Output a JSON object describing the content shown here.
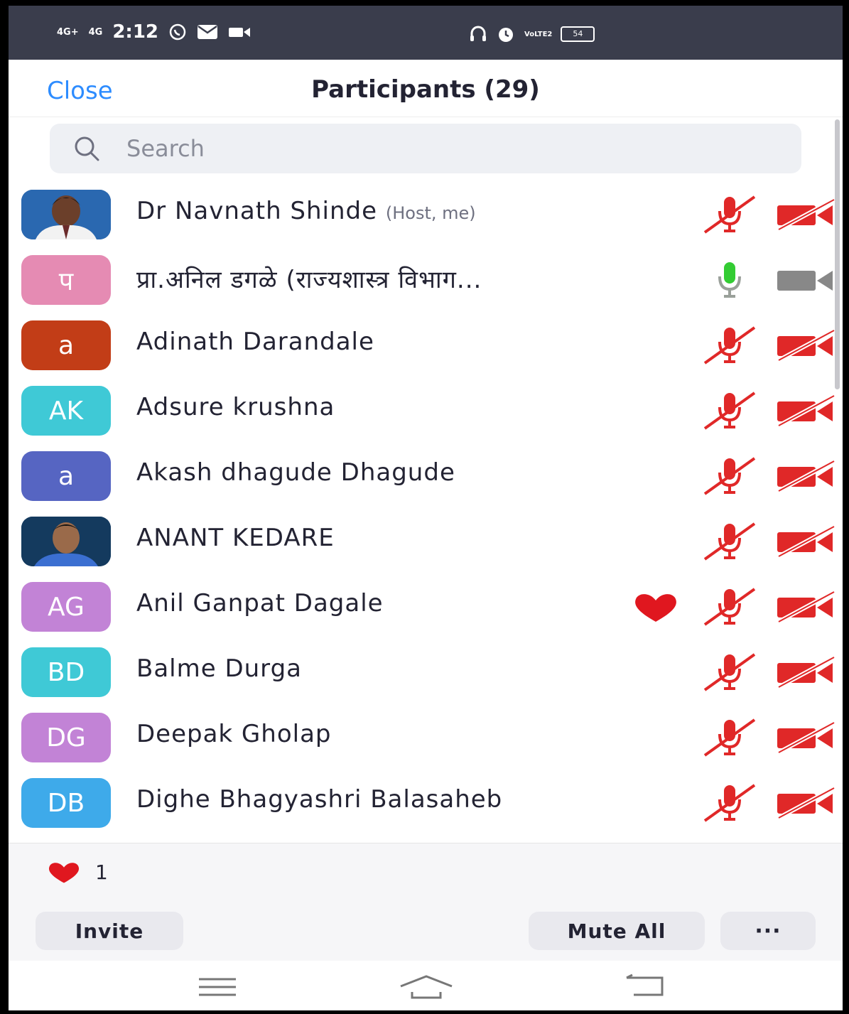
{
  "status_bar": {
    "signal1": "4G+",
    "signal2": "4G",
    "time": "2:12",
    "volte": "VoLTE2",
    "battery": "54"
  },
  "header": {
    "close_label": "Close",
    "title": "Participants (29)"
  },
  "search": {
    "placeholder": "Search"
  },
  "colors": {
    "accent": "#2d8cff",
    "muted_red": "#e02828",
    "active_mic": "#33cc33",
    "status_bar": "#3a3d4c"
  },
  "participants": [
    {
      "initials": "",
      "photo": "photo-avatar-1",
      "name": "Dr Navnath Shinde",
      "tag": "(Host, me)",
      "mic": "muted",
      "video": "off",
      "reaction": ""
    },
    {
      "initials": "प",
      "color": "#e58bb3",
      "name": "प्रा.अनिल डगळे (राज्यशास्त्र विभाग...",
      "tag": "",
      "mic": "on",
      "video": "inactive",
      "reaction": ""
    },
    {
      "initials": "a",
      "color": "#c23d17",
      "name": "Adinath Darandale",
      "tag": "",
      "mic": "muted",
      "video": "off",
      "reaction": ""
    },
    {
      "initials": "AK",
      "color": "#3fc9d6",
      "name": "Adsure krushna",
      "tag": "",
      "mic": "muted",
      "video": "off",
      "reaction": ""
    },
    {
      "initials": "a",
      "color": "#5665c2",
      "name": "Akash dhagude Dhagude",
      "tag": "",
      "mic": "muted",
      "video": "off",
      "reaction": ""
    },
    {
      "initials": "",
      "photo": "photo-avatar-2",
      "name": "ANANT KEDARE",
      "tag": "",
      "mic": "muted",
      "video": "off",
      "reaction": ""
    },
    {
      "initials": "AG",
      "color": "#c283d6",
      "name": "Anil Ganpat Dagale",
      "tag": "",
      "mic": "muted",
      "video": "off",
      "reaction": "heart"
    },
    {
      "initials": "BD",
      "color": "#3fc9d6",
      "name": "Balme Durga",
      "tag": "",
      "mic": "muted",
      "video": "off",
      "reaction": ""
    },
    {
      "initials": "DG",
      "color": "#c283d6",
      "name": "Deepak Gholap",
      "tag": "",
      "mic": "muted",
      "video": "off",
      "reaction": ""
    },
    {
      "initials": "DB",
      "color": "#3eaaea",
      "name": "Dighe Bhagyashri Balasaheb",
      "tag": "",
      "mic": "muted",
      "video": "off",
      "reaction": ""
    }
  ],
  "footer": {
    "reaction_count": "1",
    "invite_label": "Invite",
    "mute_all_label": "Mute All",
    "more_label": "···"
  }
}
